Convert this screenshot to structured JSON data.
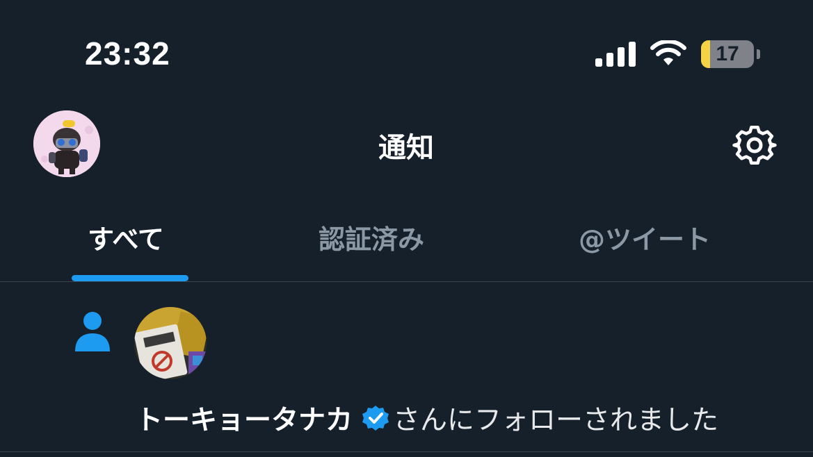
{
  "status_bar": {
    "time": "23:32",
    "battery_level": "17",
    "battery_fraction": 0.17,
    "icons": [
      "signal-icon",
      "wifi-icon",
      "battery-icon"
    ]
  },
  "header": {
    "title": "通知",
    "avatar_icon": "profile-avatar",
    "settings_icon": "gear-icon"
  },
  "tabs": [
    {
      "label": "すべて",
      "active": true
    },
    {
      "label": "認証済み",
      "active": false
    },
    {
      "label": "@ツイート",
      "active": false
    }
  ],
  "notifications": [
    {
      "type_icon": "person-icon",
      "user_name": "トーキョータナカ",
      "verified": true,
      "message_suffix": "さんにフォローされました"
    }
  ],
  "colors": {
    "background": "#15202b",
    "accent": "#1d9bf0",
    "muted_text": "#8b98a5",
    "divider": "#38444d",
    "battery_low": "#f6d245"
  }
}
